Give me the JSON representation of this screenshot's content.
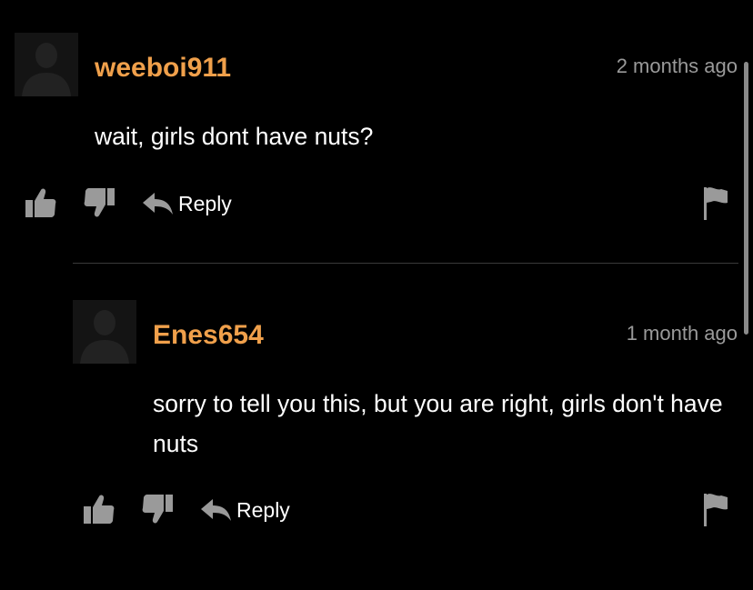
{
  "comments": [
    {
      "username": "weeboi911",
      "timestamp": "2 months ago",
      "text": "wait, girls dont have nuts?",
      "reply_label": "Reply",
      "avatar_icon": "default-avatar-silhouette"
    },
    {
      "username": "Enes654",
      "timestamp": "1 month ago",
      "text": "sorry to tell you this, but you are right, girls don't have nuts",
      "reply_label": "Reply",
      "avatar_icon": "default-avatar-silhouette"
    }
  ],
  "icons": {
    "upvote": "thumbs-up-icon",
    "downvote": "thumbs-down-icon",
    "reply": "reply-arrow-icon",
    "flag": "flag-icon"
  },
  "colors": {
    "background": "#000000",
    "username": "#f0a04b",
    "timestamp": "#9a9a9a",
    "text": "#ffffff",
    "icon": "#9a9a9a",
    "divider": "#3a3a3a"
  }
}
